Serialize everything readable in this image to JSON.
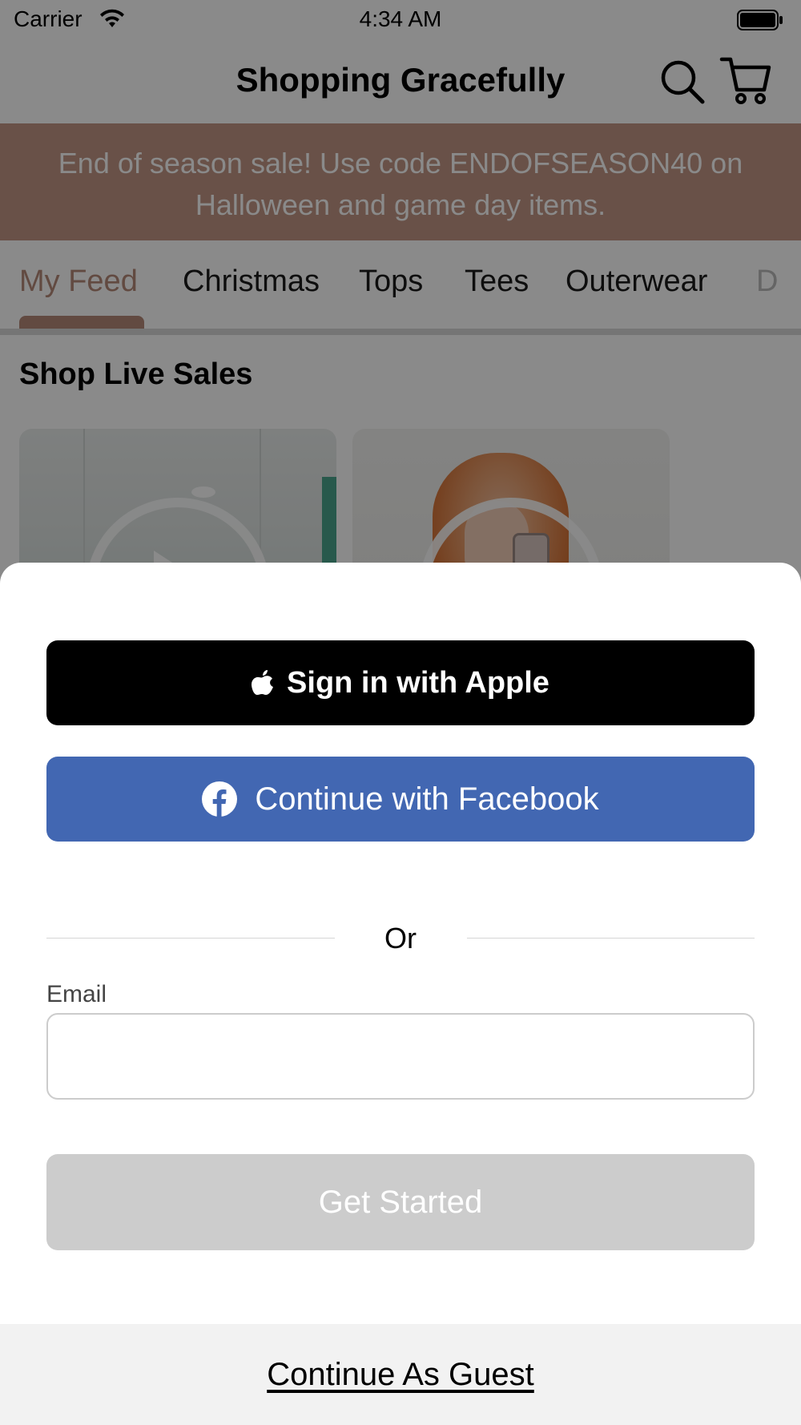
{
  "status_bar": {
    "carrier": "Carrier",
    "time": "4:34 AM"
  },
  "nav": {
    "title": "Shopping Gracefully",
    "search_icon": "search-icon",
    "cart_icon": "cart-icon"
  },
  "promo": {
    "text": "End of season sale! Use code ENDOFSEASON40 on Halloween and game day items.",
    "background_color": "#c39785"
  },
  "tabs": [
    {
      "label": "My Feed",
      "active": true
    },
    {
      "label": "Christmas",
      "active": false
    },
    {
      "label": "Tops",
      "active": false
    },
    {
      "label": "Tees",
      "active": false
    },
    {
      "label": "Outerwear",
      "active": false
    },
    {
      "label": "D",
      "active": false
    }
  ],
  "section": {
    "title": "Shop Live Sales"
  },
  "sheet": {
    "apple_button": "Sign in with Apple",
    "facebook_button": "Continue with Facebook",
    "separator": "Or",
    "email_label": "Email",
    "email_value": "",
    "get_started_button": "Get Started",
    "guest_link": "Continue As Guest"
  },
  "colors": {
    "accent": "#b58a78",
    "facebook_blue": "#4267b2",
    "apple_black": "#000000",
    "disabled_button": "#cccccc"
  }
}
